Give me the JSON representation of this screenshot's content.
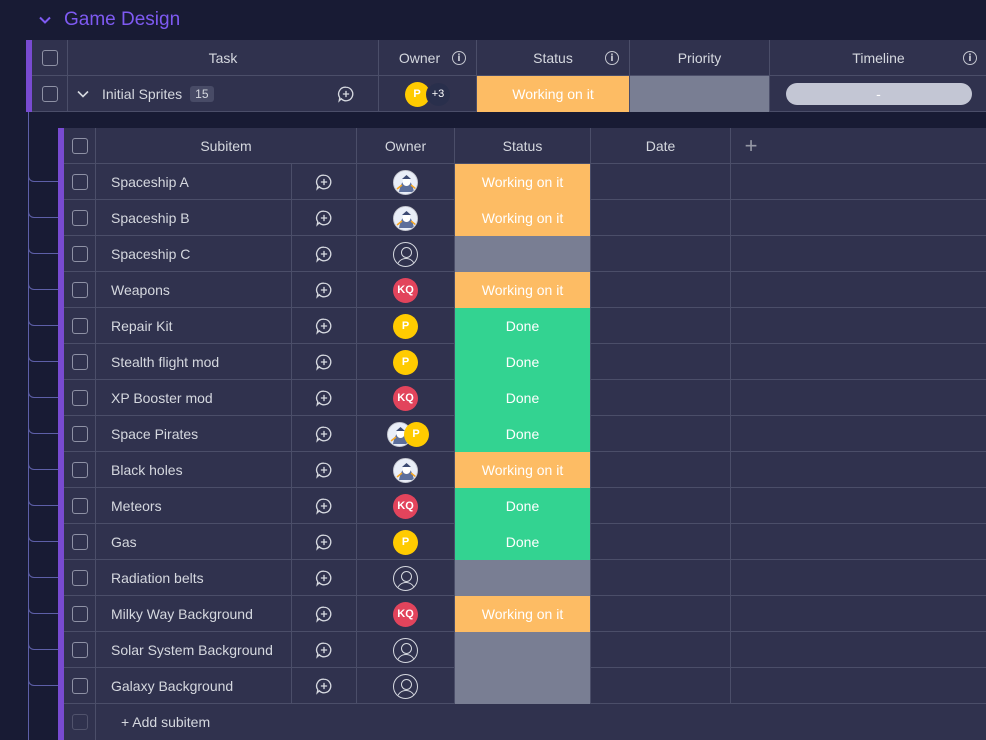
{
  "group": {
    "title": "Game Design"
  },
  "main_table": {
    "columns": {
      "task": "Task",
      "owner": "Owner",
      "status": "Status",
      "priority": "Priority",
      "timeline": "Timeline"
    },
    "row": {
      "name": "Initial Sprites",
      "count": "15",
      "owner_initial": "P",
      "owner_extra": "+3",
      "status": "Working on it",
      "timeline": "-"
    }
  },
  "sub_table": {
    "columns": {
      "subitem": "Subitem",
      "owner": "Owner",
      "status": "Status",
      "date": "Date",
      "add": "+"
    },
    "rows": [
      {
        "name": "Spaceship A",
        "status": "Working on it"
      },
      {
        "name": "Spaceship B",
        "status": "Working on it"
      },
      {
        "name": "Spaceship C",
        "status": ""
      },
      {
        "name": "Weapons",
        "owner": "KQ",
        "status": "Working on it"
      },
      {
        "name": "Repair Kit",
        "owner": "P",
        "status": "Done"
      },
      {
        "name": "Stealth flight mod",
        "owner": "P",
        "status": "Done"
      },
      {
        "name": "XP Booster mod",
        "owner": "KQ",
        "status": "Done"
      },
      {
        "name": "Space Pirates",
        "owner": "P",
        "status": "Done"
      },
      {
        "name": "Black holes",
        "status": "Working on it"
      },
      {
        "name": "Meteors",
        "owner": "KQ",
        "status": "Done"
      },
      {
        "name": "Gas",
        "owner": "P",
        "status": "Done"
      },
      {
        "name": "Radiation belts",
        "status": ""
      },
      {
        "name": "Milky Way Background",
        "owner": "KQ",
        "status": "Working on it"
      },
      {
        "name": "Solar System Background",
        "status": ""
      },
      {
        "name": "Galaxy Background",
        "status": ""
      }
    ],
    "add_label": "+ Add subitem"
  },
  "colors": {
    "accent": "#784bd1",
    "working": "#fdbc64",
    "done": "#33d391",
    "empty": "#797e93",
    "kq": "#e2445c",
    "p": "#ffcb00"
  }
}
